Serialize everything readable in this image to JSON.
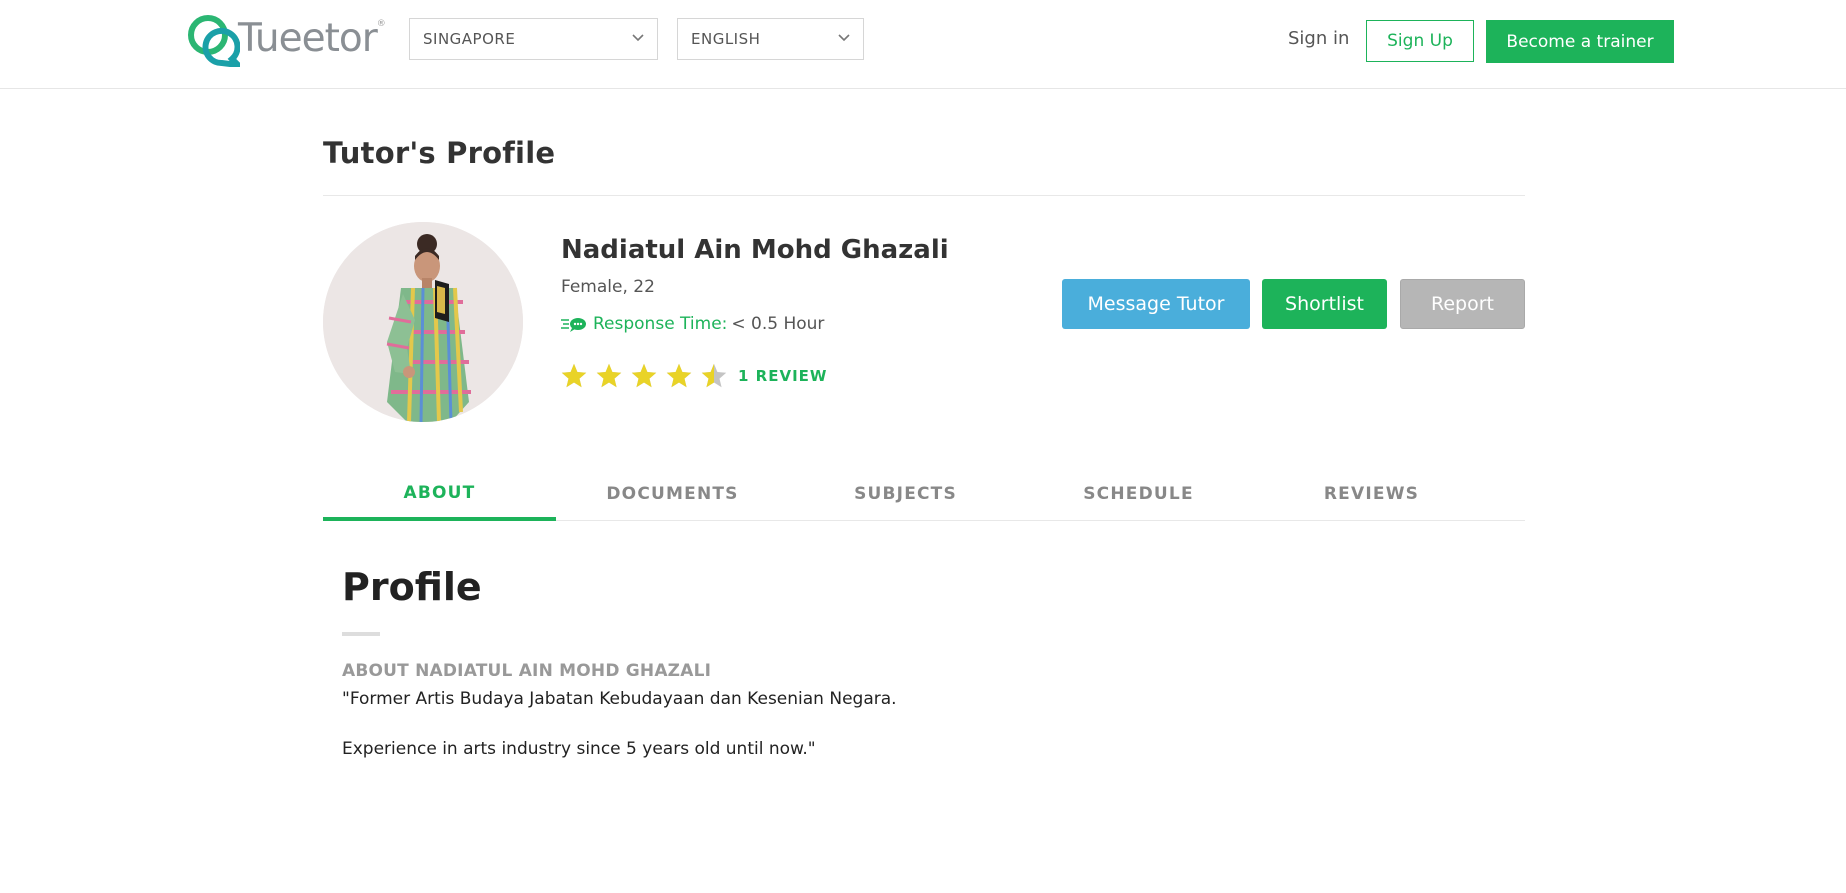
{
  "header": {
    "logo_text": "Tueetor",
    "logo_tm": "®",
    "country_select": {
      "value": "SINGAPORE",
      "icon": "chevron-down-icon"
    },
    "language_select": {
      "value": "ENGLISH",
      "icon": "chevron-down-icon"
    },
    "sign_in": "Sign in",
    "sign_up": "Sign Up",
    "become_trainer": "Become a trainer"
  },
  "page": {
    "title": "Tutor's Profile"
  },
  "tutor": {
    "name": "Nadiatul Ain Mohd Ghazali",
    "gender_age": "Female, 22",
    "response_label": "Response Time:",
    "response_value": "< 0.5 Hour",
    "rating": 4.5,
    "rating_max": 5,
    "review_count_label": "1 REVIEW"
  },
  "actions": {
    "message": "Message Tutor",
    "shortlist": "Shortlist",
    "report": "Report"
  },
  "tabs": [
    {
      "label": "ABOUT",
      "active": true
    },
    {
      "label": "DOCUMENTS",
      "active": false
    },
    {
      "label": "SUBJECTS",
      "active": false
    },
    {
      "label": "SCHEDULE",
      "active": false
    },
    {
      "label": "REVIEWS",
      "active": false
    }
  ],
  "about": {
    "section_title": "Profile",
    "heading": "ABOUT NADIATUL AIN MOHD GHAZALI",
    "paragraph1": "\"Former Artis Budaya Jabatan Kebudayaan dan Kesenian Negara.",
    "paragraph2": "Experience in arts industry since 5 years old until now.\""
  },
  "colors": {
    "brand_green": "#1db35a",
    "message_blue": "#4aaedb",
    "report_gray": "#b6b6b6",
    "star_yellow": "#e9d327",
    "star_empty": "#c4c4c4"
  }
}
